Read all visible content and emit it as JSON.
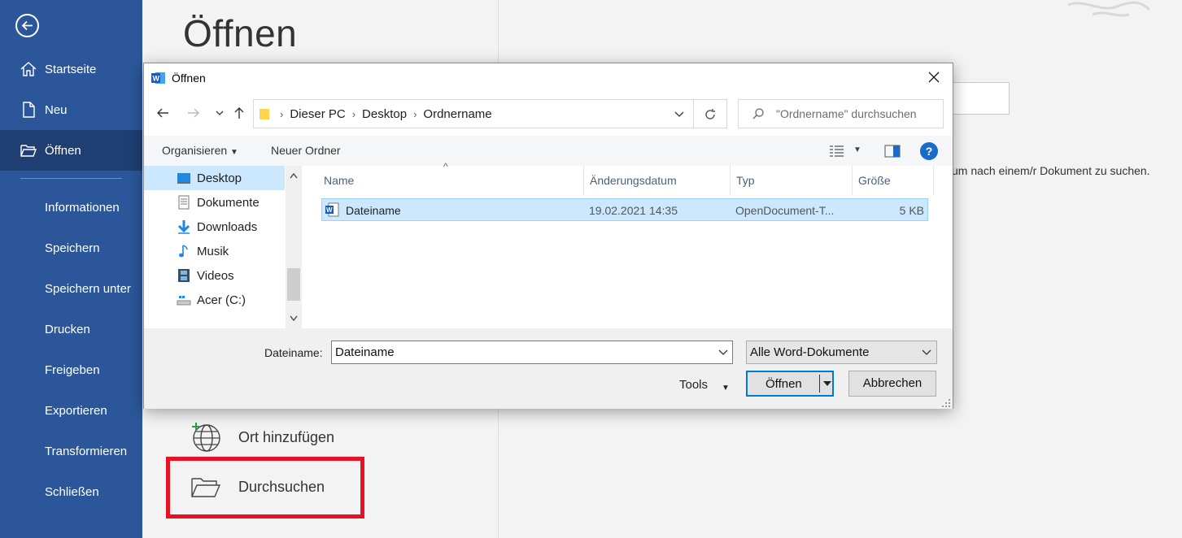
{
  "backstage": {
    "page_title": "Öffnen",
    "nav": {
      "home": "Startseite",
      "new": "Neu",
      "open": "Öffnen",
      "info": "Informationen",
      "save": "Speichern",
      "save_as": "Speichern unter",
      "print": "Drucken",
      "share": "Freigeben",
      "export": "Exportieren",
      "transform": "Transformieren",
      "close": "Schließen"
    },
    "places": {
      "add_place": "Ort hinzufügen",
      "browse": "Durchsuchen"
    },
    "hint_text": "um nach einem/r Dokument zu suchen.",
    "highlight_color": "#e81123",
    "accent_color": "#2b579a"
  },
  "dialog": {
    "title": "Öffnen",
    "breadcrumb": [
      "Dieser PC",
      "Desktop",
      "Ordnername"
    ],
    "search_placeholder": "\"Ordnername\" durchsuchen",
    "toolbar": {
      "organize": "Organisieren",
      "new_folder": "Neuer Ordner"
    },
    "nav_tree": [
      "Desktop",
      "Dokumente",
      "Downloads",
      "Musik",
      "Videos",
      "Acer (C:)"
    ],
    "columns": {
      "name": "Name",
      "modified": "Änderungsdatum",
      "type": "Typ",
      "size": "Größe"
    },
    "files": [
      {
        "name": "Dateiname",
        "modified": "19.02.2021 14:35",
        "type": "OpenDocument-T...",
        "size": "5 KB"
      }
    ],
    "filename_label": "Dateiname:",
    "filename_value": "Dateiname",
    "filetype_value": "Alle Word-Dokumente",
    "tools_label": "Tools",
    "open_label": "Öffnen",
    "cancel_label": "Abbrechen"
  }
}
